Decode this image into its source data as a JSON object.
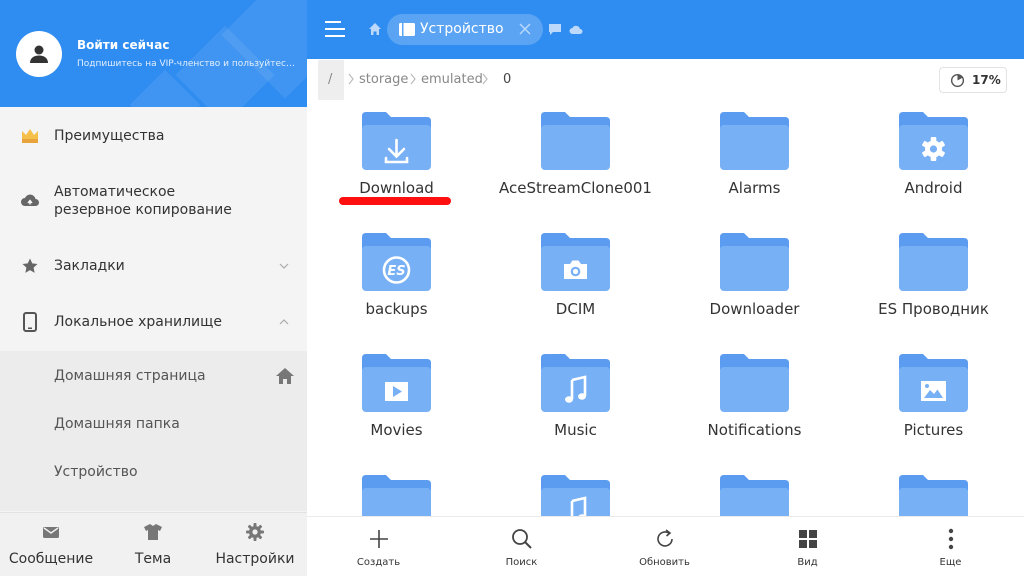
{
  "profile": {
    "title": "Войти сейчас",
    "subtitle": "Подпишитесь на VIP-членство и пользуйтесь вс..."
  },
  "sidebar": {
    "items": [
      {
        "label": "Преимущества",
        "icon": "crown-icon"
      },
      {
        "label": "Автоматическое",
        "label2": "резервное копирование",
        "icon": "cloud-backup-icon"
      },
      {
        "label": "Закладки",
        "icon": "star-icon"
      },
      {
        "label": "Локальное хранилище",
        "icon": "phone-icon"
      }
    ],
    "sub_items": [
      {
        "label": "Домашняя страница"
      },
      {
        "label": "Домашняя папка"
      },
      {
        "label": "Устройство"
      }
    ],
    "bottom": [
      {
        "label": "Сообщение",
        "icon": "message-icon"
      },
      {
        "label": "Тема",
        "icon": "shirt-icon"
      },
      {
        "label": "Настройки",
        "icon": "gear-icon"
      }
    ]
  },
  "topbar": {
    "tab_label": "Устройство"
  },
  "breadcrumb": {
    "root": "/",
    "parts": [
      "storage",
      "emulated",
      "0"
    ]
  },
  "storage": {
    "percent_label": "17%",
    "used_fraction": 0.17
  },
  "folders": [
    {
      "name": "Download",
      "glyph": "download"
    },
    {
      "name": "AceStreamClone001",
      "glyph": "none"
    },
    {
      "name": "Alarms",
      "glyph": "none"
    },
    {
      "name": "Android",
      "glyph": "gear"
    },
    {
      "name": "backups",
      "glyph": "es"
    },
    {
      "name": "DCIM",
      "glyph": "camera"
    },
    {
      "name": "Downloader",
      "glyph": "none"
    },
    {
      "name": "ES Проводник",
      "glyph": "none"
    },
    {
      "name": "Movies",
      "glyph": "play"
    },
    {
      "name": "Music",
      "glyph": "note"
    },
    {
      "name": "Notifications",
      "glyph": "none"
    },
    {
      "name": "Pictures",
      "glyph": "picture"
    },
    {
      "name": "",
      "glyph": "none"
    },
    {
      "name": "",
      "glyph": "note"
    },
    {
      "name": "",
      "glyph": "none"
    },
    {
      "name": "",
      "glyph": "none"
    }
  ],
  "toolbar": [
    {
      "label": "Создать",
      "icon": "plus-icon"
    },
    {
      "label": "Поиск",
      "icon": "search-icon"
    },
    {
      "label": "Обновить",
      "icon": "refresh-icon"
    },
    {
      "label": "Вид",
      "icon": "grid-view-icon"
    },
    {
      "label": "Еще",
      "icon": "more-icon"
    }
  ],
  "colors": {
    "accent": "#2f8cf0",
    "folder_back": "#5b9cf1",
    "folder_front": "#78b0f5",
    "highlight": "#ff1010"
  }
}
